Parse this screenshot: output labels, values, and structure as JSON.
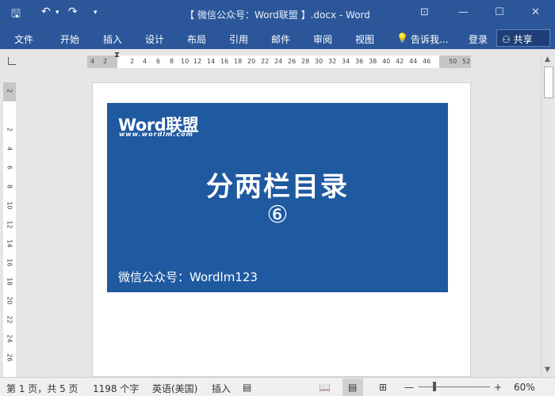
{
  "titlebar": {
    "title": "【 微信公众号：Word联盟 】.docx - Word",
    "quick_access": {
      "save": "🖫",
      "undo": "↶",
      "undo_drop": "▾",
      "redo": "↷",
      "customize": "▾"
    },
    "window_controls": {
      "ribbon_options": "⊡",
      "minimize": "—",
      "maximize": "☐",
      "close": "✕"
    }
  },
  "ribbon": {
    "tabs": [
      "文件",
      "开始",
      "插入",
      "设计",
      "布局",
      "引用",
      "邮件",
      "审阅",
      "视图"
    ],
    "tell_me": "告诉我...",
    "tell_me_icon": "💡",
    "login": "登录",
    "share": "共享",
    "share_icon": "⚇"
  },
  "ruler": {
    "left_ticks": [
      "4",
      "2"
    ],
    "ticks": [
      "2",
      "4",
      "6",
      "8",
      "10",
      "12",
      "14",
      "16",
      "18",
      "20",
      "22",
      "24",
      "26",
      "28",
      "30",
      "32",
      "34",
      "36",
      "38",
      "40",
      "42",
      "44",
      "46"
    ],
    "right_ticks": [
      "50",
      "52"
    ],
    "vertical_ticks": [
      "2",
      "2",
      "4",
      "6",
      "8",
      "10",
      "12",
      "14",
      "16",
      "18",
      "20",
      "22",
      "24",
      "26"
    ]
  },
  "document": {
    "logo": "Word联盟",
    "logo_url": "www.wordlm.com",
    "headline": "分两栏目录",
    "number": "⑥",
    "footer": "微信公众号：Wordlm123"
  },
  "statusbar": {
    "page": "第 1 页，共 5 页",
    "words": "1198 个字",
    "language": "英语(美国)",
    "mode": "插入",
    "zoom_minus": "—",
    "zoom_plus": "+",
    "zoom": "60%"
  },
  "colors": {
    "brand": "#2b579a",
    "banner": "#1f5aa0"
  }
}
